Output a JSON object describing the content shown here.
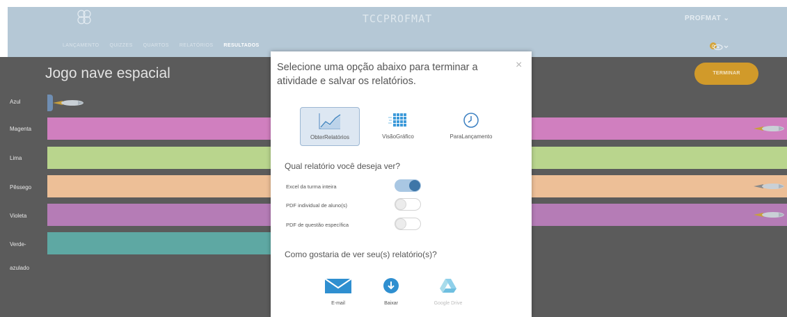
{
  "header": {
    "brand": "TCCPROFMAT",
    "user_menu": "PROFMAT ⌄",
    "nav": [
      "LANÇAMENTO",
      "QUIZZES",
      "QUARTOS",
      "RELATÓRIOS",
      "RESULTADOS"
    ],
    "active_nav": "RESULTADOS",
    "notification_count": "0"
  },
  "game": {
    "title": "Jogo nave espacial",
    "finish_label": "TERMINAR",
    "lanes": [
      {
        "label": "Azul",
        "color": "#5b5b5b"
      },
      {
        "label": "Magenta",
        "color": "#d07fbf"
      },
      {
        "label": "Lima",
        "color": "#b9d58d"
      },
      {
        "label": "Pêssego",
        "color": "#edbf97"
      },
      {
        "label": "Violeta",
        "color": "#b57cb6"
      },
      {
        "label": "Verde-",
        "color": "#5ea8a3"
      },
      {
        "label": "azulado",
        "color": "#5b5b5b"
      }
    ]
  },
  "modal": {
    "title": "Selecione uma opção abaixo para terminar a atividade e salvar os relatórios.",
    "close_icon": "×",
    "options": [
      {
        "label": "ObterRelatórios",
        "icon": "line-chart-icon",
        "selected": true
      },
      {
        "label": "VisãoGráfico",
        "icon": "grid-chart-icon",
        "selected": false
      },
      {
        "label": "ParaLançamento",
        "icon": "clock-icon",
        "selected": false
      }
    ],
    "report_question": "Qual relatório você deseja ver?",
    "reports": [
      {
        "label": "Excel da turma inteira",
        "on": true
      },
      {
        "label": "PDF individual de aluno(s)",
        "on": false
      },
      {
        "label": "PDF de questão específica",
        "on": false
      }
    ],
    "view_question": "Como gostaria de ver seu(s) relatório(s)?",
    "share": [
      {
        "label": "E-mail",
        "icon": "envelope-icon",
        "enabled": true
      },
      {
        "label": "Baixar",
        "icon": "download-icon",
        "enabled": true
      },
      {
        "label": "Google Drive",
        "icon": "google-drive-icon",
        "enabled": false
      }
    ]
  },
  "colors": {
    "accent_blue": "#3e76a8",
    "finish_orange": "#d19a2a",
    "header_bg": "#b5c8d6"
  }
}
